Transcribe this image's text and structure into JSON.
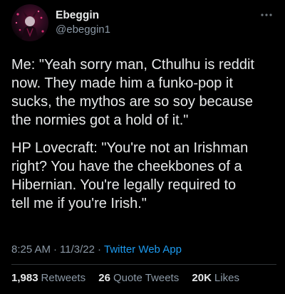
{
  "user": {
    "display_name": "Ebeggin",
    "handle": "@ebeggin1"
  },
  "tweet": {
    "paragraphs": [
      "Me: \"Yeah sorry man, Cthulhu is reddit\nnow. They made him a funko-pop it\nsucks, the mythos are so soy because\nthe normies got a hold of it.\"",
      "HP Lovecraft: \"You're not an Irishman\nright? You have the cheekbones of a\nHibernian. You're legally required to\ntell me if you're Irish.\""
    ]
  },
  "meta": {
    "time": "8:25 AM",
    "date": "11/3/22",
    "separator": "·",
    "source": "Twitter Web App"
  },
  "stats": {
    "retweets_count": "1,983",
    "retweets_label": "Retweets",
    "quotes_count": "26",
    "quotes_label": "Quote Tweets",
    "likes_count": "20K",
    "likes_label": "Likes"
  },
  "icons": {
    "more": "more-horizontal-icon",
    "avatar": "avatar-image"
  },
  "colors": {
    "background": "#000000",
    "text": "#e7e9ea",
    "secondary": "#8b98a5",
    "link": "#1d9bf0",
    "divider": "#2f3336"
  }
}
